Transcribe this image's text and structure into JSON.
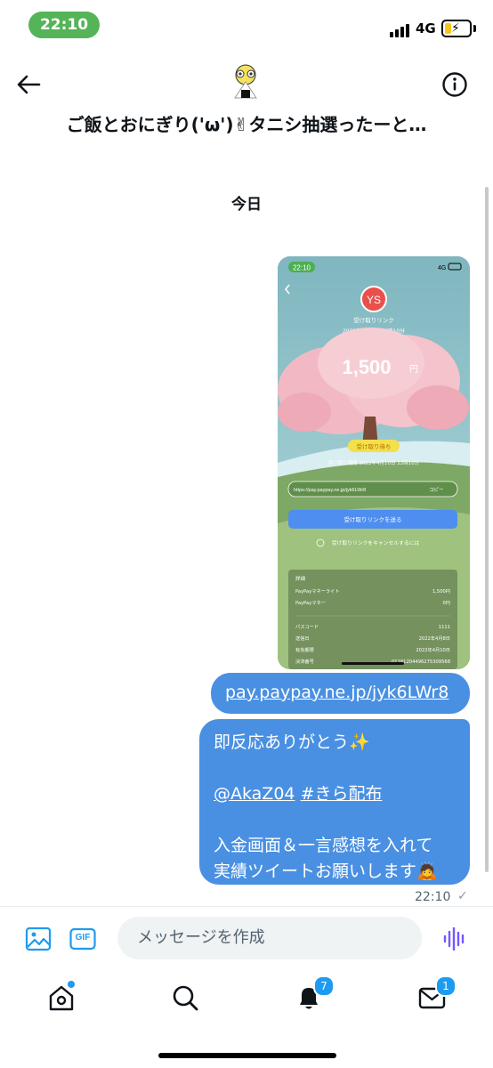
{
  "status_bar": {
    "time": "22:10",
    "network": "4G",
    "battery_level": 0.25,
    "battery_color": "#f5c518",
    "time_pill_color": "#4caf50"
  },
  "header": {
    "back_icon": "arrow-left-icon",
    "info_icon": "info-icon",
    "avatar_icon": "onigiri-avatar",
    "title": "ご飯とおにぎり('ω')✌タニシ抽選ったーと…"
  },
  "conversation": {
    "day_label": "今日",
    "image_message": {
      "status_time": "22:10",
      "status_network": "4G",
      "title": "受け取りリンク",
      "date": "2022年4月8日 22時10分",
      "amount": "1,500",
      "currency": "円",
      "status_badge": "受け取り待ち",
      "expiry": "受け取り期限 2022年4月10日 22時10分",
      "link_text": "https://pay.paypay.ne.jp/jyk6LWr8",
      "copy_label": "コピー",
      "send_button": "受け取りリンクを送る",
      "cancel_text": "受け取りリンクをキャンセルするには",
      "details": {
        "heading": "詳細",
        "rows": [
          {
            "label": "PayPayマネーライト",
            "value": "1,500円"
          },
          {
            "label": "PayPayマネー",
            "value": "0円"
          }
        ],
        "rows2": [
          {
            "label": "パスコード",
            "value": "1111"
          },
          {
            "label": "送信日",
            "value": "2022年4月8日"
          },
          {
            "label": "有効期限",
            "value": "2022年4月10日"
          },
          {
            "label": "決済番号",
            "value": "01181204496275309568"
          }
        ]
      }
    },
    "link_bubble": "pay.paypay.ne.jp/jyk6LWr8",
    "main_bubble": {
      "line1": "即反応ありがとう✨",
      "mention": "@AkaZ04",
      "hashtag": "#きら配布",
      "line3": "入金画面＆一言感想を入れて",
      "line4": "実績ツイートお願いします🙇"
    },
    "timestamp": "22:10",
    "read_mark": "✓",
    "bubble_color": "#4a90e2"
  },
  "composer": {
    "image_icon": "image-icon",
    "gif_label": "GIF",
    "placeholder": "メッセージを作成",
    "voice_icon": "voice-wave-icon",
    "accent_color": "#1d9bf0"
  },
  "tab_bar": {
    "items": [
      {
        "icon": "home-icon",
        "badge": ""
      },
      {
        "icon": "search-icon",
        "badge": ""
      },
      {
        "icon": "bell-icon",
        "badge": "7"
      },
      {
        "icon": "mail-icon",
        "badge": "1"
      }
    ]
  }
}
